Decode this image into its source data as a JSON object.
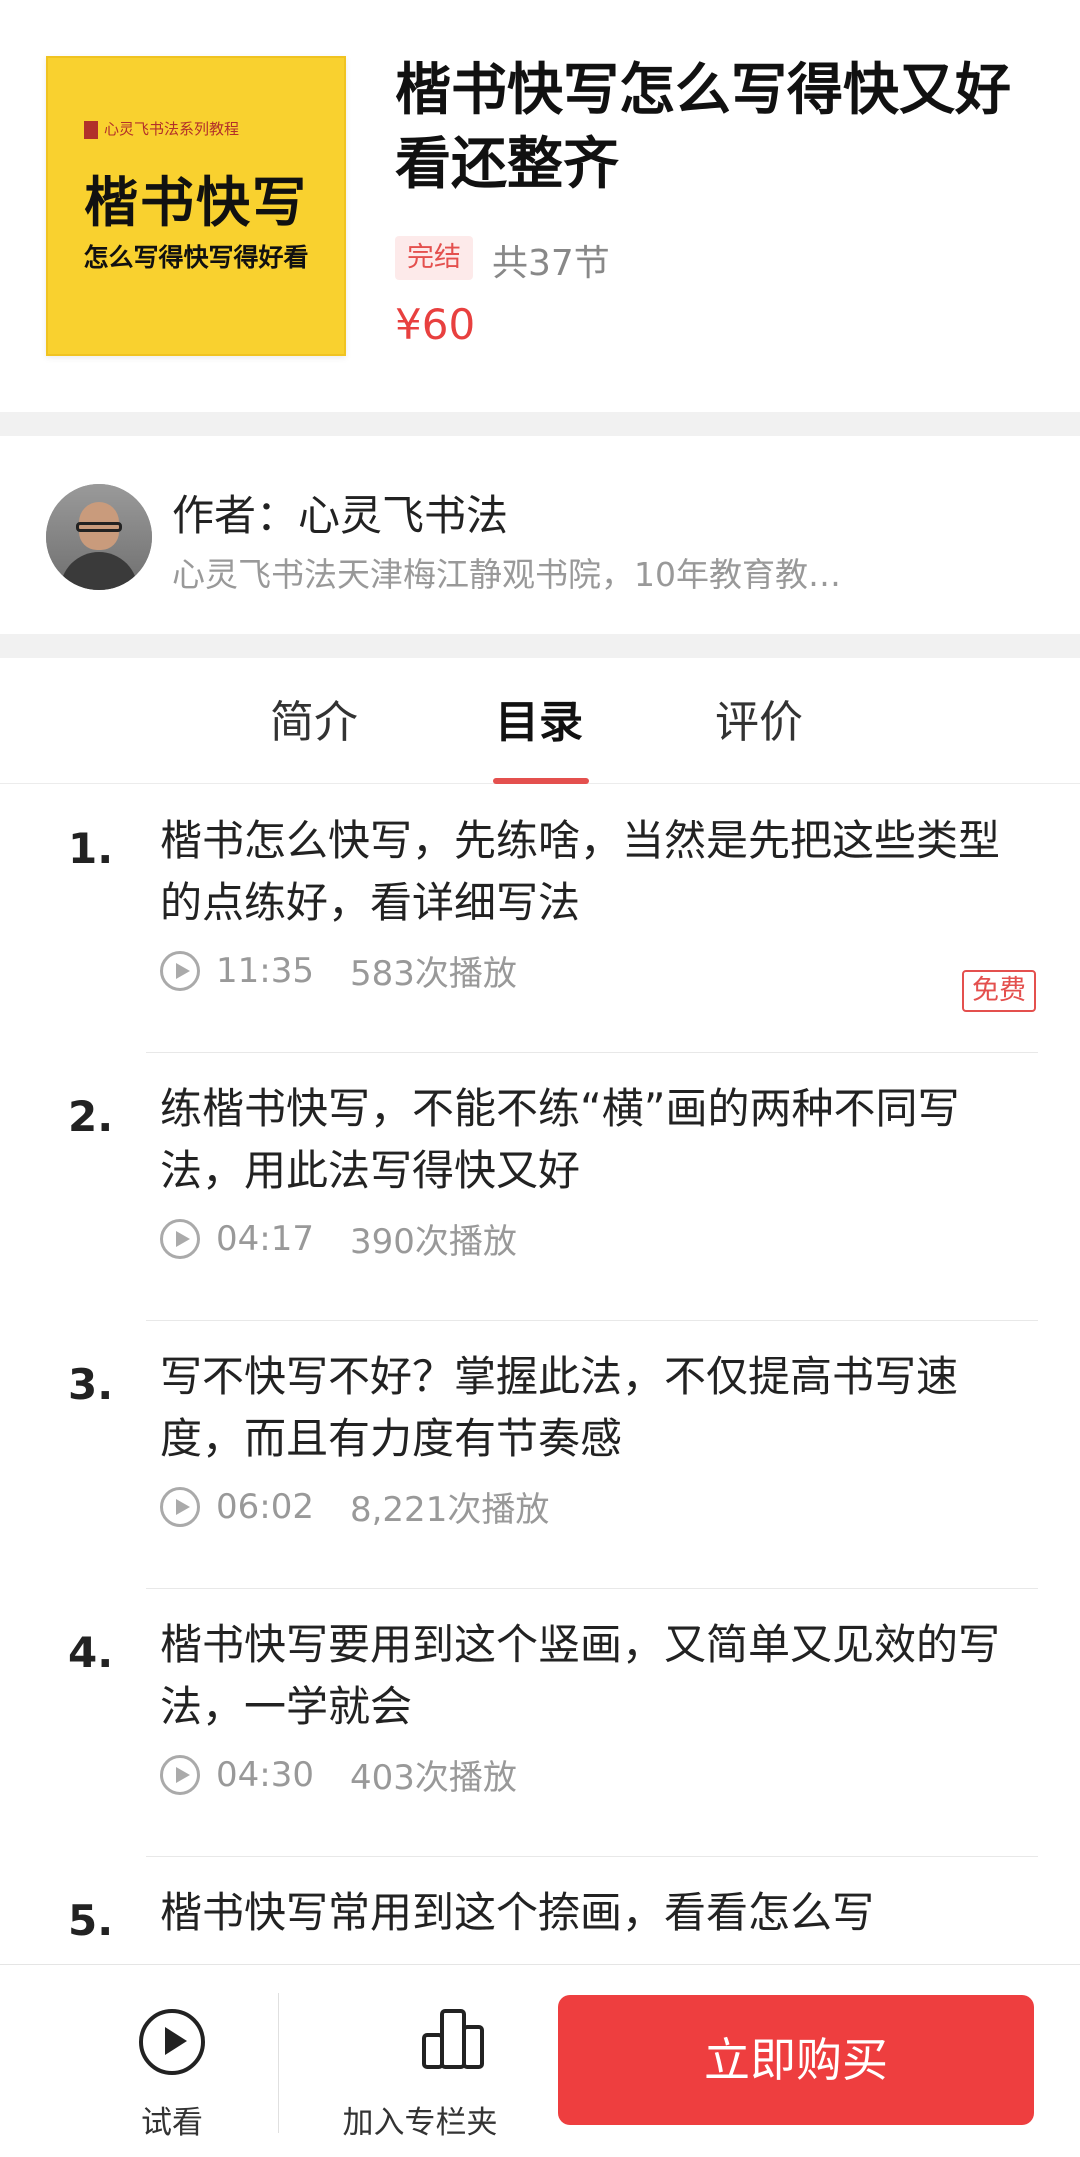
{
  "course": {
    "cover": {
      "series": "心灵飞书法系列教程",
      "big_title": "楷书快写",
      "subtitle": "怎么写得快写得好看",
      "bg_color": "#f9d12f"
    },
    "title": "楷书快写怎么写得快又好看还整齐",
    "status": "完结",
    "lesson_count": "共37节",
    "price": "¥60"
  },
  "author": {
    "name": "作者：心灵飞书法",
    "bio": "心灵飞书法天津梅江静观书院，10年教育教…"
  },
  "tabs": [
    {
      "label": "简介",
      "active": false
    },
    {
      "label": "目录",
      "active": true
    },
    {
      "label": "评价",
      "active": false
    }
  ],
  "catalog": [
    {
      "num": "1.",
      "title": "楷书怎么快写，先练啥，当然是先把这些类型的点练好，看详细写法",
      "duration": "11:35",
      "plays": "583次播放",
      "badge": "免费"
    },
    {
      "num": "2.",
      "title": "练楷书快写，不能不练“横”画的两种不同写法，用此法写得快又好",
      "duration": "04:17",
      "plays": "390次播放"
    },
    {
      "num": "3.",
      "title": "写不快写不好？掌握此法，不仅提高书写速度，而且有力度有节奏感",
      "duration": "06:02",
      "plays": "8,221次播放"
    },
    {
      "num": "4.",
      "title": "楷书快写要用到这个竖画，又简单又见效的写法，一学就会",
      "duration": "04:30",
      "plays": "403次播放"
    },
    {
      "num": "5.",
      "title": "楷书快写常用到这个捺画，看看怎么写"
    }
  ],
  "bottom_bar": {
    "try_label": "试看",
    "shelf_label": "加入专栏夹",
    "buy_label": "立即购买"
  },
  "colors": {
    "accent": "#e4504e",
    "buy_button": "#ee3e3f"
  },
  "icons": [
    "play-circle-icon",
    "shelf-icon"
  ]
}
